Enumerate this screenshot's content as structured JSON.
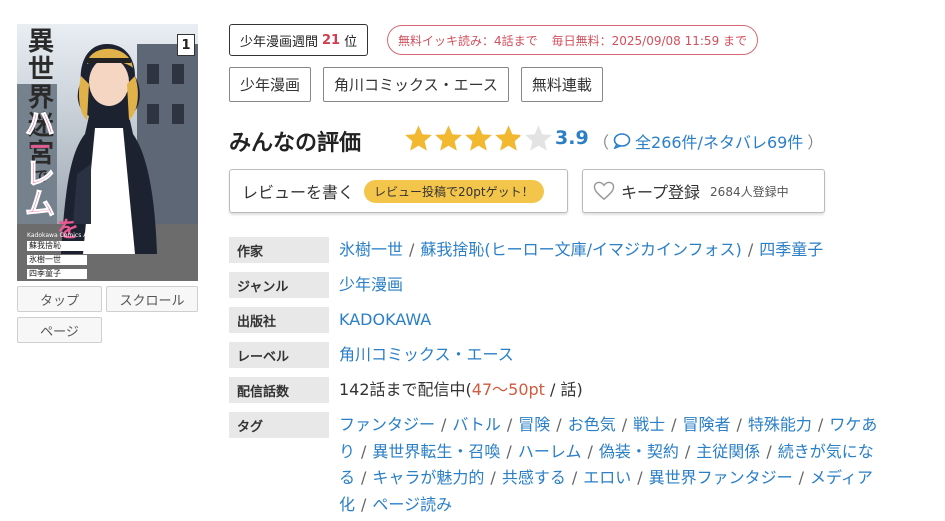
{
  "cover": {
    "title_vertical": [
      "異",
      "世",
      "界",
      "迷",
      "宮",
      "で",
      "ハ",
      "ー",
      "レ",
      "ム",
      "を"
    ],
    "volume": "1",
    "credits": [
      "蘇我捨恥",
      "氷樹一世",
      "四季童子"
    ],
    "publisher_mark": "Kadokawa Comics A"
  },
  "view_buttons": [
    "タップ",
    "スクロール",
    "ページ"
  ],
  "ranking": {
    "prefix": "少年漫画週間",
    "number": "21",
    "suffix": "位"
  },
  "free_badge": {
    "ikki": "無料イッキ読み：4話まで",
    "daily": "毎日無料：2025/09/08 11:59 まで"
  },
  "category_tags": [
    "少年漫画",
    "角川コミックス・エース",
    "無料連載"
  ],
  "rating": {
    "title": "みんなの評価",
    "score": "3.9",
    "score_value": 3.9,
    "max": 5,
    "counts_open": "（",
    "counts": "全266件/ネタバレ69件",
    "counts_close": "）"
  },
  "review_button": {
    "label": "レビューを書く",
    "pill": "レビュー投稿で20ptゲット！"
  },
  "keep_button": {
    "label": "キープ登録",
    "count": "2684人登録中"
  },
  "info": {
    "author_label": "作家",
    "authors": [
      "氷樹一世",
      "蘇我捨恥(ヒーロー文庫/イマジカインフォス)",
      "四季童子"
    ],
    "genre_label": "ジャンル",
    "genre": "少年漫画",
    "publisher_label": "出版社",
    "publisher": "KADOKAWA",
    "label_label": "レーベル",
    "label": "角川コミックス・エース",
    "episodes_label": "配信話数",
    "episodes_prefix": "142話まで配信中(",
    "episodes_price": "47〜50pt",
    "episodes_suffix": " / 話)",
    "tags_label": "タグ",
    "tags": [
      "ファンタジー",
      "バトル",
      "冒険",
      "お色気",
      "戦士",
      "冒険者",
      "特殊能力",
      "ワケあり",
      "異世界転生・召喚",
      "ハーレム",
      "偽装・契約",
      "主従関係",
      "続きが気になる",
      "キャラが魅力的",
      "共感する",
      "エロい",
      "異世界ファンタジー",
      "メディア化",
      "ページ読み"
    ]
  },
  "colors": {
    "link": "#2a7fc7",
    "star": "#f2b830",
    "rank": "#d23c4e",
    "free": "#d2505c",
    "pill": "#f3c54a"
  }
}
